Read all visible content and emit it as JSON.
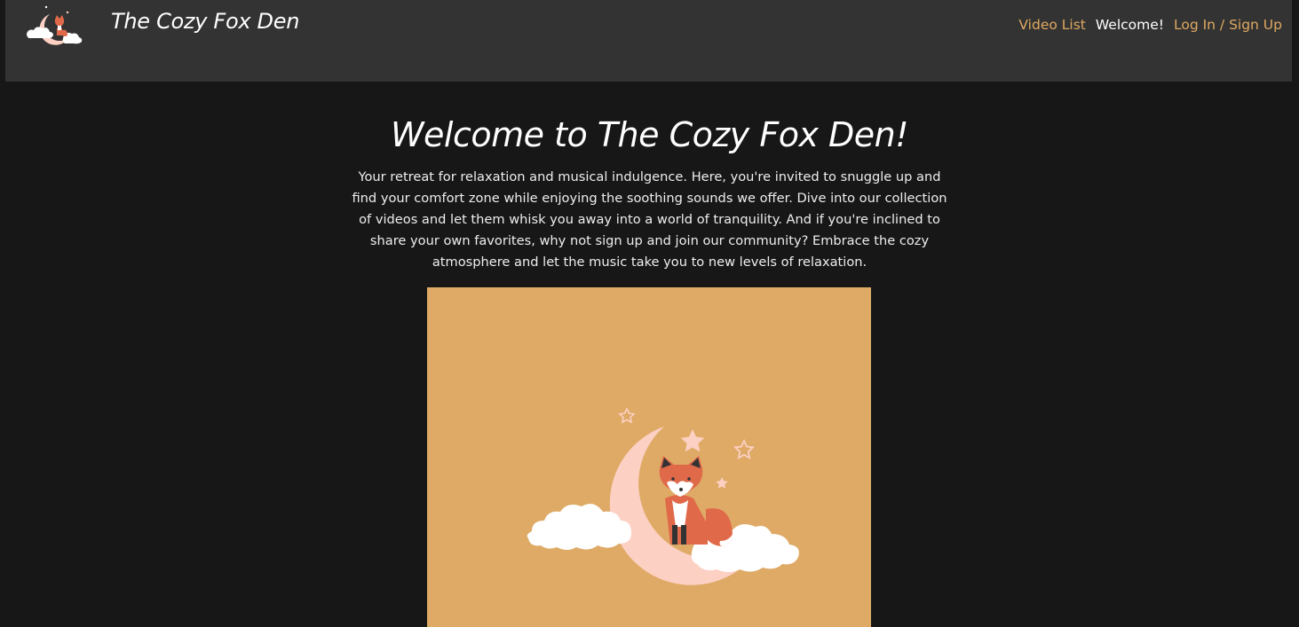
{
  "header": {
    "site_title": "The Cozy Fox Den",
    "logo_icon": "fox-on-moon-logo"
  },
  "nav": {
    "video_list": "Video List",
    "welcome": "Welcome!",
    "login_signup": "Log In / Sign Up"
  },
  "hero": {
    "title": "Welcome to The Cozy Fox Den!",
    "description": "Your retreat for relaxation and musical indulgence. Here, you're invited to snuggle up and find your comfort zone while enjoying the soothing sounds we offer. Dive into our collection of videos and let them whisk you away into a world of tranquility. And if you're inclined to share your own favorites, why not sign up and join our community? Embrace the cozy atmosphere and let the music take you to new levels of relaxation.",
    "illustration": "fox-on-crescent-moon-illustration"
  },
  "colors": {
    "page_bg": "#171717",
    "header_bg": "#333333",
    "accent": "#dfa961",
    "image_bg": "#deaa66",
    "moon": "#fdd0c4",
    "fox": "#e0694a"
  }
}
